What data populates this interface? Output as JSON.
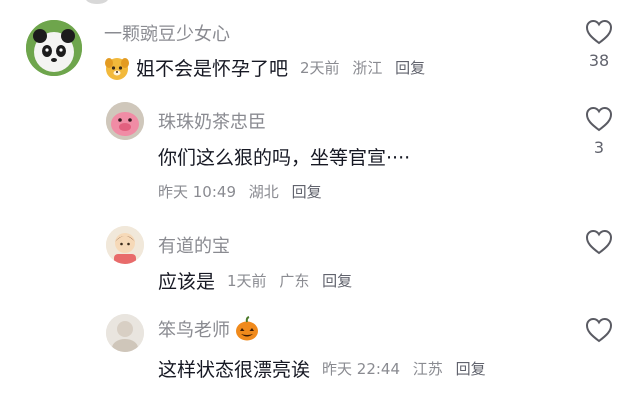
{
  "comments": [
    {
      "username": "一颗豌豆少女心",
      "text": "姐不会是怀孕了吧",
      "time": "2天前",
      "location": "浙江",
      "reply": "回复",
      "likes": "38",
      "avatar_icon": "panda-avatar",
      "inline_icon": "dog-emoji-icon"
    },
    {
      "username": "珠珠奶茶忠臣",
      "text": "你们这么狠的吗，坐等官宣····",
      "time": "昨天 10:49",
      "location": "湖北",
      "reply": "回复",
      "likes": "3",
      "avatar_icon": "pink-pig-avatar"
    },
    {
      "username": "有道的宝",
      "text": "应该是",
      "time": "1天前",
      "location": "广东",
      "reply": "回复",
      "likes": "",
      "avatar_icon": "cartoon-avatar"
    },
    {
      "username": "笨鸟老师",
      "text": "这样状态很漂亮诶",
      "time": "昨天 22:44",
      "location": "江苏",
      "reply": "回复",
      "likes": "",
      "avatar_icon": "pale-avatar",
      "name_icon": "pumpkin-emoji-icon"
    }
  ],
  "colors": {
    "text": "#161823",
    "secondary": "#8a8b91",
    "heart_stroke": "#5a5b63"
  }
}
